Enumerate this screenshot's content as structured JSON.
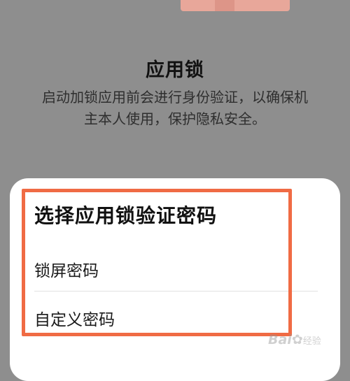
{
  "header": {
    "title": "应用锁",
    "description_lines": [
      "启动加锁应用前会进行身份验证，以确保机",
      "主本人使用，保护隐私安全。"
    ]
  },
  "sheet": {
    "title": "选择应用锁验证密码",
    "options": [
      {
        "label": "锁屏密码"
      },
      {
        "label": "自定义密码"
      }
    ]
  },
  "watermark": {
    "brand_left": "Bai",
    "brand_right": "经验"
  },
  "colors": {
    "background_dim": "#8e8e8e",
    "highlight": "#f06b44",
    "sheet": "#ffffff"
  }
}
